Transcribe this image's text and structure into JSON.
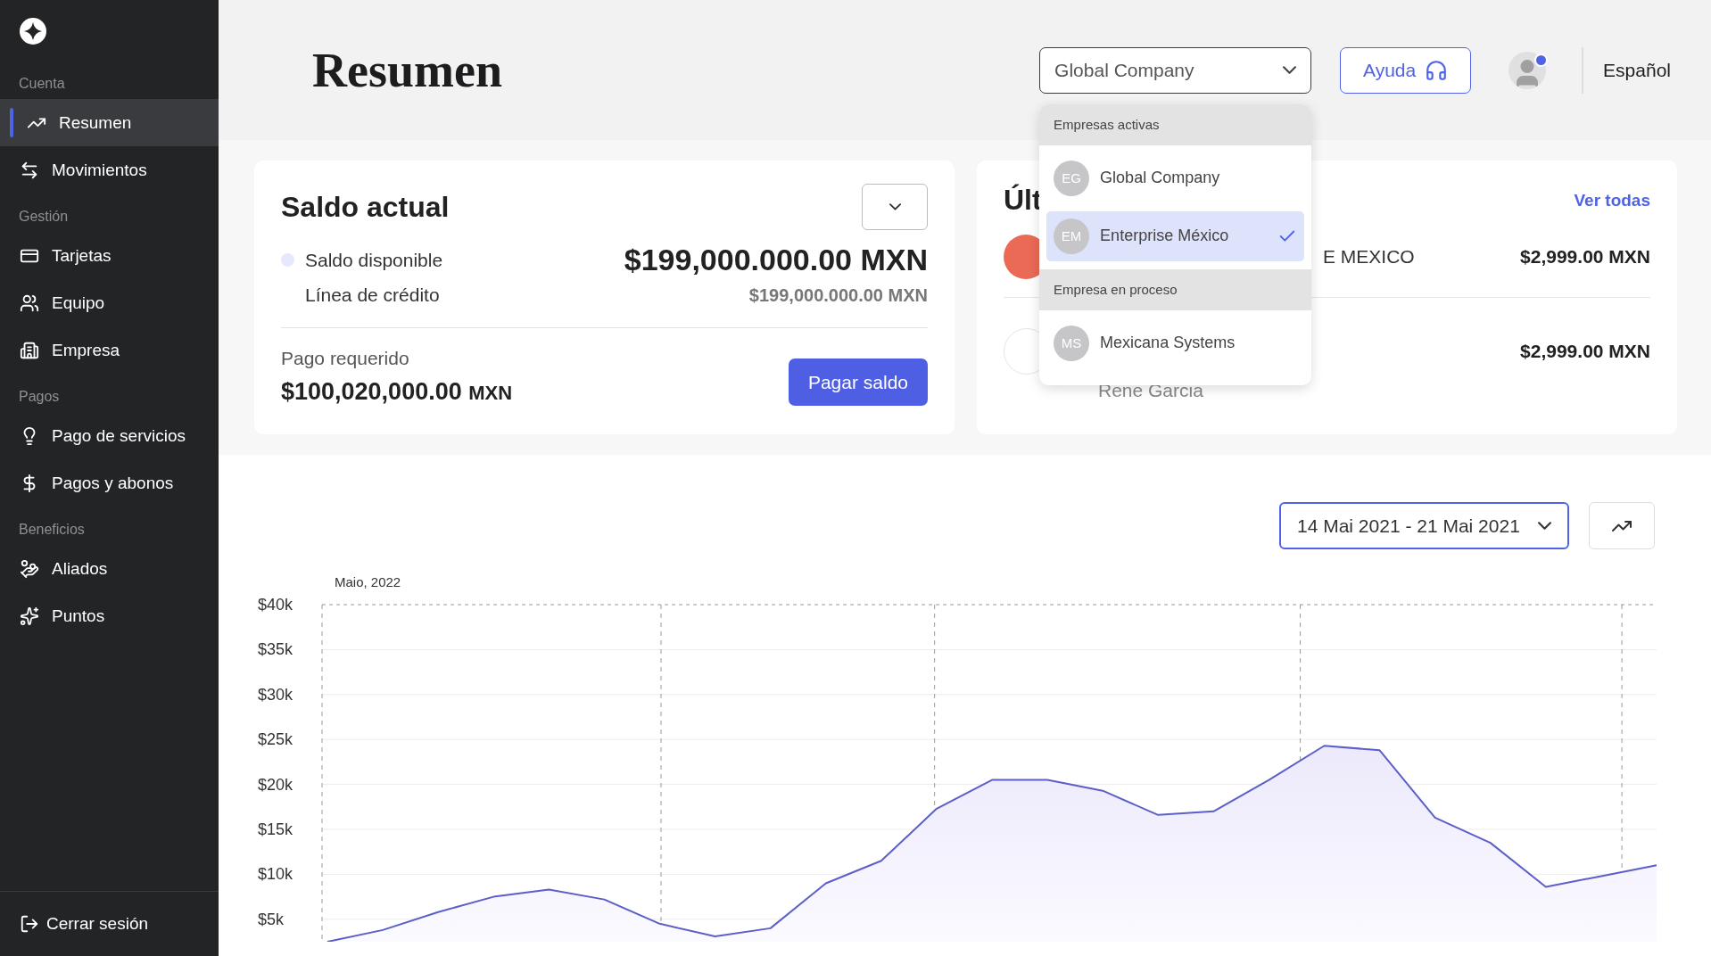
{
  "sidebar": {
    "sections": [
      {
        "label": "Cuenta",
        "items": [
          {
            "label": "Resumen",
            "selected": true
          },
          {
            "label": "Movimientos",
            "selected": false
          }
        ]
      },
      {
        "label": "Gestión",
        "items": [
          {
            "label": "Tarjetas",
            "selected": false
          },
          {
            "label": "Equipo",
            "selected": false
          },
          {
            "label": "Empresa",
            "selected": false
          }
        ]
      },
      {
        "label": "Pagos",
        "items": [
          {
            "label": "Pago de servicios",
            "selected": false
          },
          {
            "label": "Pagos y abonos",
            "selected": false
          }
        ]
      },
      {
        "label": "Beneficios",
        "items": [
          {
            "label": "Aliados",
            "selected": false
          },
          {
            "label": "Puntos",
            "selected": false
          }
        ]
      }
    ],
    "logout": "Cerrar sesión"
  },
  "header": {
    "title": "Resumen",
    "company_select": {
      "value": "Global Company",
      "expanded": true
    },
    "help_button": "Ayuda",
    "avatar_notification": true,
    "language": "Español"
  },
  "company_menu": [
    {
      "label": "Empresas activas",
      "items": [
        {
          "initials": "EG",
          "name": "Global Company",
          "selected": false
        },
        {
          "initials": "EM",
          "name": "Enterprise México",
          "selected": true
        }
      ]
    },
    {
      "label": "Empresa en proceso",
      "items": [
        {
          "initials": "MS",
          "name": "Mexicana Systems",
          "selected": false
        }
      ]
    }
  ],
  "balance_card": {
    "title": "Saldo actual",
    "rows": [
      {
        "kind": "primary",
        "label": "Saldo disponible",
        "amount": "$199,000.000.00 MXN"
      },
      {
        "kind": "secondary",
        "label": "Línea de crédito",
        "amount": "$199,000.000.00 MXN"
      }
    ],
    "payment_label": "Pago requerido",
    "payment_amount": "$100,020,000.00",
    "payment_currency": "MXN",
    "pay_button": "Pagar saldo"
  },
  "recent_card": {
    "title": "Últ",
    "link": "Ver todas",
    "rows": [
      {
        "kind": "red",
        "description": "E MEXICO",
        "amount": "$2,999.00 MXN"
      },
      {
        "kind": "white",
        "subtitle": "Rene Garcia",
        "amount": "$2,999.00 MXN"
      }
    ]
  },
  "chart_controls": {
    "date_range": "14 Mai 2021 - 21 Mai 2021"
  },
  "chart": {
    "chart_data": {
      "type": "area",
      "grid": true,
      "title": "Maio, 2022",
      "categories": [
        null,
        null,
        null,
        null,
        null,
        null,
        null,
        null,
        null,
        null,
        null,
        null,
        null,
        null,
        null,
        null,
        null,
        null,
        null,
        null,
        null,
        null,
        null,
        null,
        null
      ],
      "ylim": [
        2500,
        40000
      ],
      "yticks": [
        {
          "value": 5000,
          "label": "$5k"
        },
        {
          "value": 10000,
          "label": "$10k"
        },
        {
          "value": 15000,
          "label": "$15k"
        },
        {
          "value": 20000,
          "label": "$20k"
        },
        {
          "value": 25000,
          "label": "$25k"
        },
        {
          "value": 30000,
          "label": "$30k"
        },
        {
          "value": 35000,
          "label": "$35k"
        },
        {
          "value": 40000,
          "label": "$40k"
        }
      ],
      "series": [
        {
          "color": "#5b5fc7",
          "values": [
            2500,
            3800,
            5800,
            7500,
            8300,
            7200,
            4500,
            3100,
            4000,
            9000,
            11500,
            17300,
            20500,
            20500,
            19300,
            16600,
            17000,
            20500,
            24300,
            23800,
            16300,
            13500,
            8600,
            9800,
            11000
          ]
        }
      ]
    }
  }
}
